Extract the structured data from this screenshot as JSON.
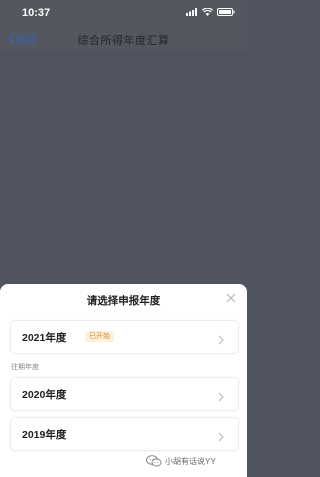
{
  "status_bar": {
    "time": "10:37"
  },
  "nav": {
    "back_label": "返回",
    "title": "综合所得年度汇算"
  },
  "sheet": {
    "title": "请选择申报年度",
    "current_year": {
      "label": "2021年度",
      "badge": "已开始"
    },
    "past_section_label": "往期年度",
    "past_years": [
      {
        "label": "2020年度"
      },
      {
        "label": "2019年度"
      }
    ]
  },
  "watermark": {
    "text": "小胡有话说YY"
  },
  "colors": {
    "accent_blue": "#3b63b8",
    "badge_text": "#e48a1f",
    "badge_bg": "#fdf0dd",
    "overlay": "#505460"
  }
}
